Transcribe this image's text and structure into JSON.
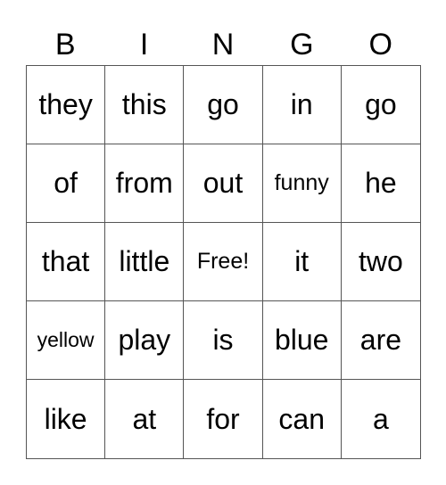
{
  "header": [
    "B",
    "I",
    "N",
    "G",
    "O"
  ],
  "cells": [
    [
      "they",
      "this",
      "go",
      "in",
      "go"
    ],
    [
      "of",
      "from",
      "out",
      "funny",
      "he"
    ],
    [
      "that",
      "little",
      "Free!",
      "it",
      "two"
    ],
    [
      "yellow",
      "play",
      "is",
      "blue",
      "are"
    ],
    [
      "like",
      "at",
      "for",
      "can",
      "a"
    ]
  ]
}
